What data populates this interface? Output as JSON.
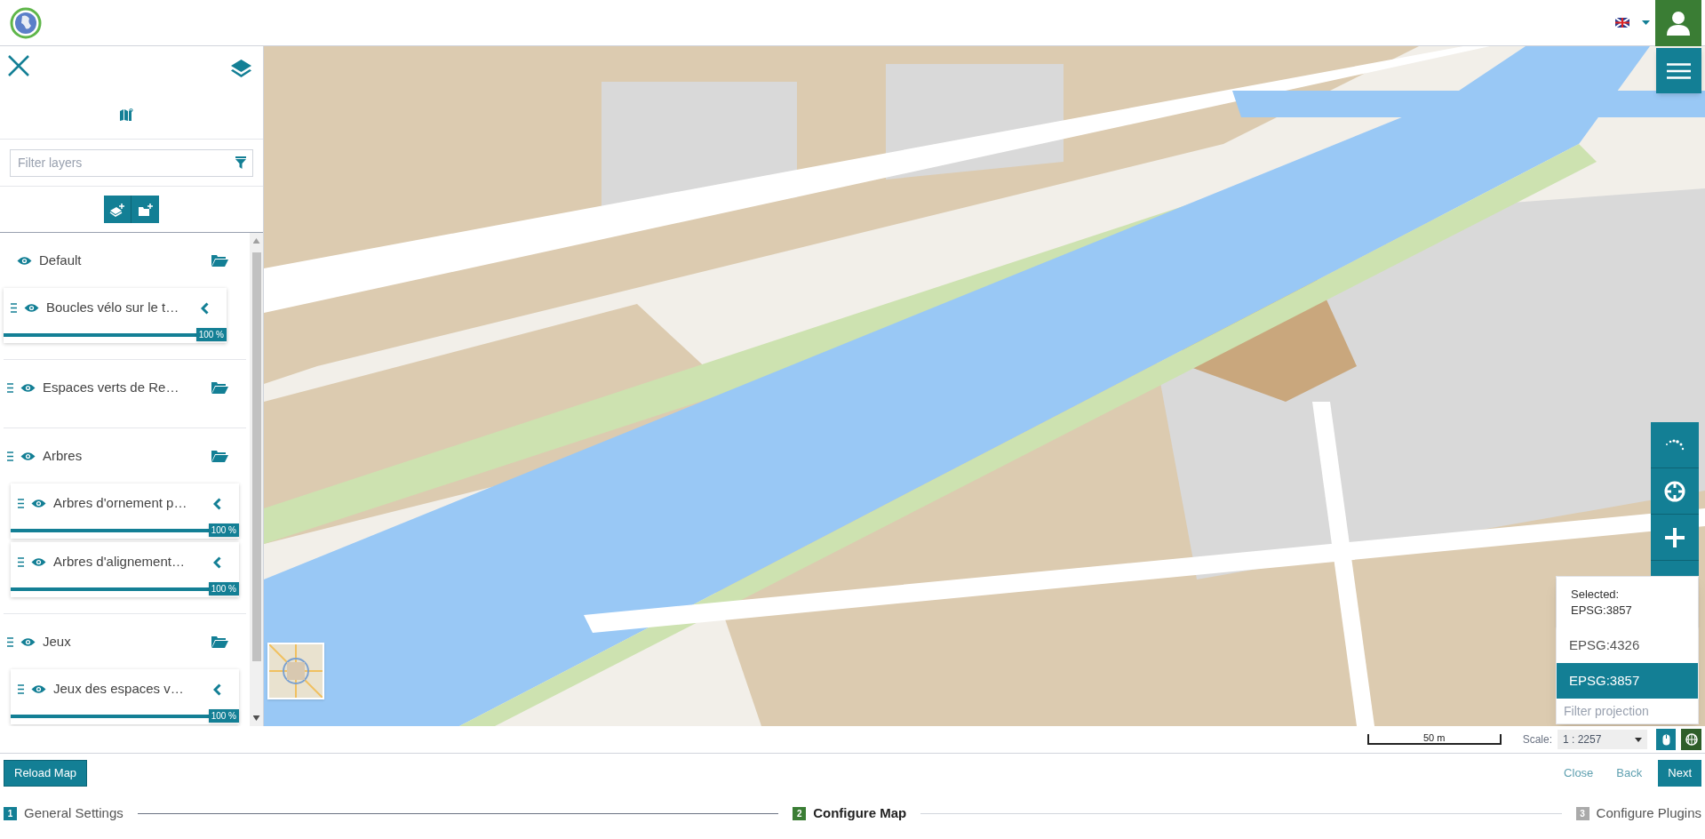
{
  "layer_panel": {
    "filter": {
      "placeholder": "Filter layers"
    },
    "layers": [
      {
        "label": "Default",
        "draggable": false,
        "children": [
          {
            "label": "Boucles vélo sur le t…",
            "level": 1,
            "reading": "100 %"
          }
        ]
      },
      {
        "label": "Espaces verts de Re…",
        "draggable": true
      },
      {
        "label": "Arbres",
        "draggable": true,
        "children": [
          {
            "label": "Arbres d'ornement p…",
            "level": 1,
            "reading": "100 %"
          },
          {
            "label": "Arbres d'alignement…",
            "level": 1,
            "reading": "100 %"
          }
        ]
      },
      {
        "label": "Jeux",
        "draggable": true,
        "children": [
          {
            "label": "Jeux des espaces v…",
            "level": 1,
            "reading": "100 %"
          }
        ]
      }
    ]
  },
  "projection": {
    "selected_label": "Selected:",
    "selected_value": "EPSG:3857",
    "options": [
      {
        "label": "EPSG:4326",
        "selected": false
      },
      {
        "label": "EPSG:3857",
        "selected": true
      }
    ],
    "placeholder": "Filter projection"
  },
  "scale": {
    "bar_label": "50 m",
    "label": "Scale:",
    "value": "1 : 2257"
  },
  "buttons": {
    "reload": "Reload Map",
    "close": "Close",
    "back": "Back",
    "next": "Next"
  },
  "steps": [
    {
      "number": "1",
      "label": "General Settings",
      "done": true,
      "selected": false
    },
    {
      "number": "2",
      "label": "Configure Map",
      "done": false,
      "selected": true
    },
    {
      "number": "3",
      "label": "Configure Plugins",
      "done": false,
      "selected": false
    }
  ]
}
